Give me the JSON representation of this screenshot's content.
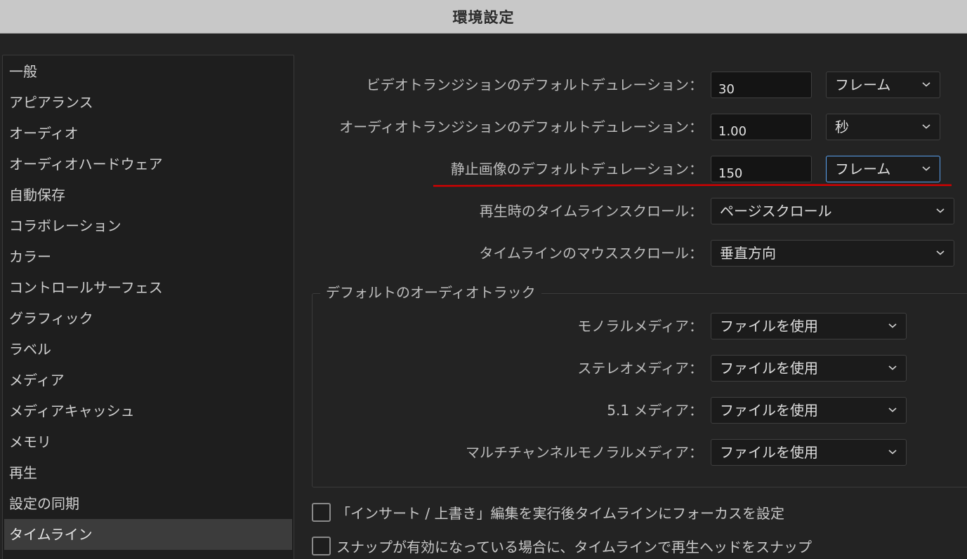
{
  "window": {
    "title": "環境設定"
  },
  "sidebar": {
    "items": [
      {
        "label": "一般"
      },
      {
        "label": "アピアランス"
      },
      {
        "label": "オーディオ"
      },
      {
        "label": "オーディオハードウェア"
      },
      {
        "label": "自動保存"
      },
      {
        "label": "コラボレーション"
      },
      {
        "label": "カラー"
      },
      {
        "label": "コントロールサーフェス"
      },
      {
        "label": "グラフィック"
      },
      {
        "label": "ラベル"
      },
      {
        "label": "メディア"
      },
      {
        "label": "メディアキャッシュ"
      },
      {
        "label": "メモリ"
      },
      {
        "label": "再生"
      },
      {
        "label": "設定の同期"
      },
      {
        "label": "タイムライン",
        "selected": true
      }
    ]
  },
  "settings": {
    "video_transition": {
      "label": "ビデオトランジションのデフォルトデュレーション：",
      "value": "30",
      "unit": "フレーム"
    },
    "audio_transition": {
      "label": "オーディオトランジションのデフォルトデュレーション：",
      "value": "1.00",
      "unit": "秒"
    },
    "still_image": {
      "label": "静止画像のデフォルトデュレーション：",
      "value": "150",
      "unit": "フレーム"
    },
    "playback_scroll": {
      "label": "再生時のタイムラインスクロール：",
      "value": "ページスクロール"
    },
    "mouse_scroll": {
      "label": "タイムラインのマウススクロール：",
      "value": "垂直方向"
    }
  },
  "audio_tracks": {
    "title": "デフォルトのオーディオトラック",
    "mono": {
      "label": "モノラルメディア：",
      "value": "ファイルを使用"
    },
    "stereo": {
      "label": "ステレオメディア：",
      "value": "ファイルを使用"
    },
    "surround": {
      "label": "5.1 メディア：",
      "value": "ファイルを使用"
    },
    "multi_mono": {
      "label": "マルチチャンネルモノラルメディア：",
      "value": "ファイルを使用"
    }
  },
  "checkboxes": {
    "insert_overwrite": {
      "label": "「インサート / 上書き」編集を実行後タイムラインにフォーカスを設定",
      "checked": false
    },
    "snap_playhead": {
      "label": "スナップが有効になっている場合に、タイムラインで再生ヘッドをスナップ",
      "checked": false
    }
  },
  "colors": {
    "highlight_underline": "#d40000",
    "focus_border": "#5aa2f0"
  },
  "icons": {
    "dropdown": "chevron-down-icon"
  }
}
